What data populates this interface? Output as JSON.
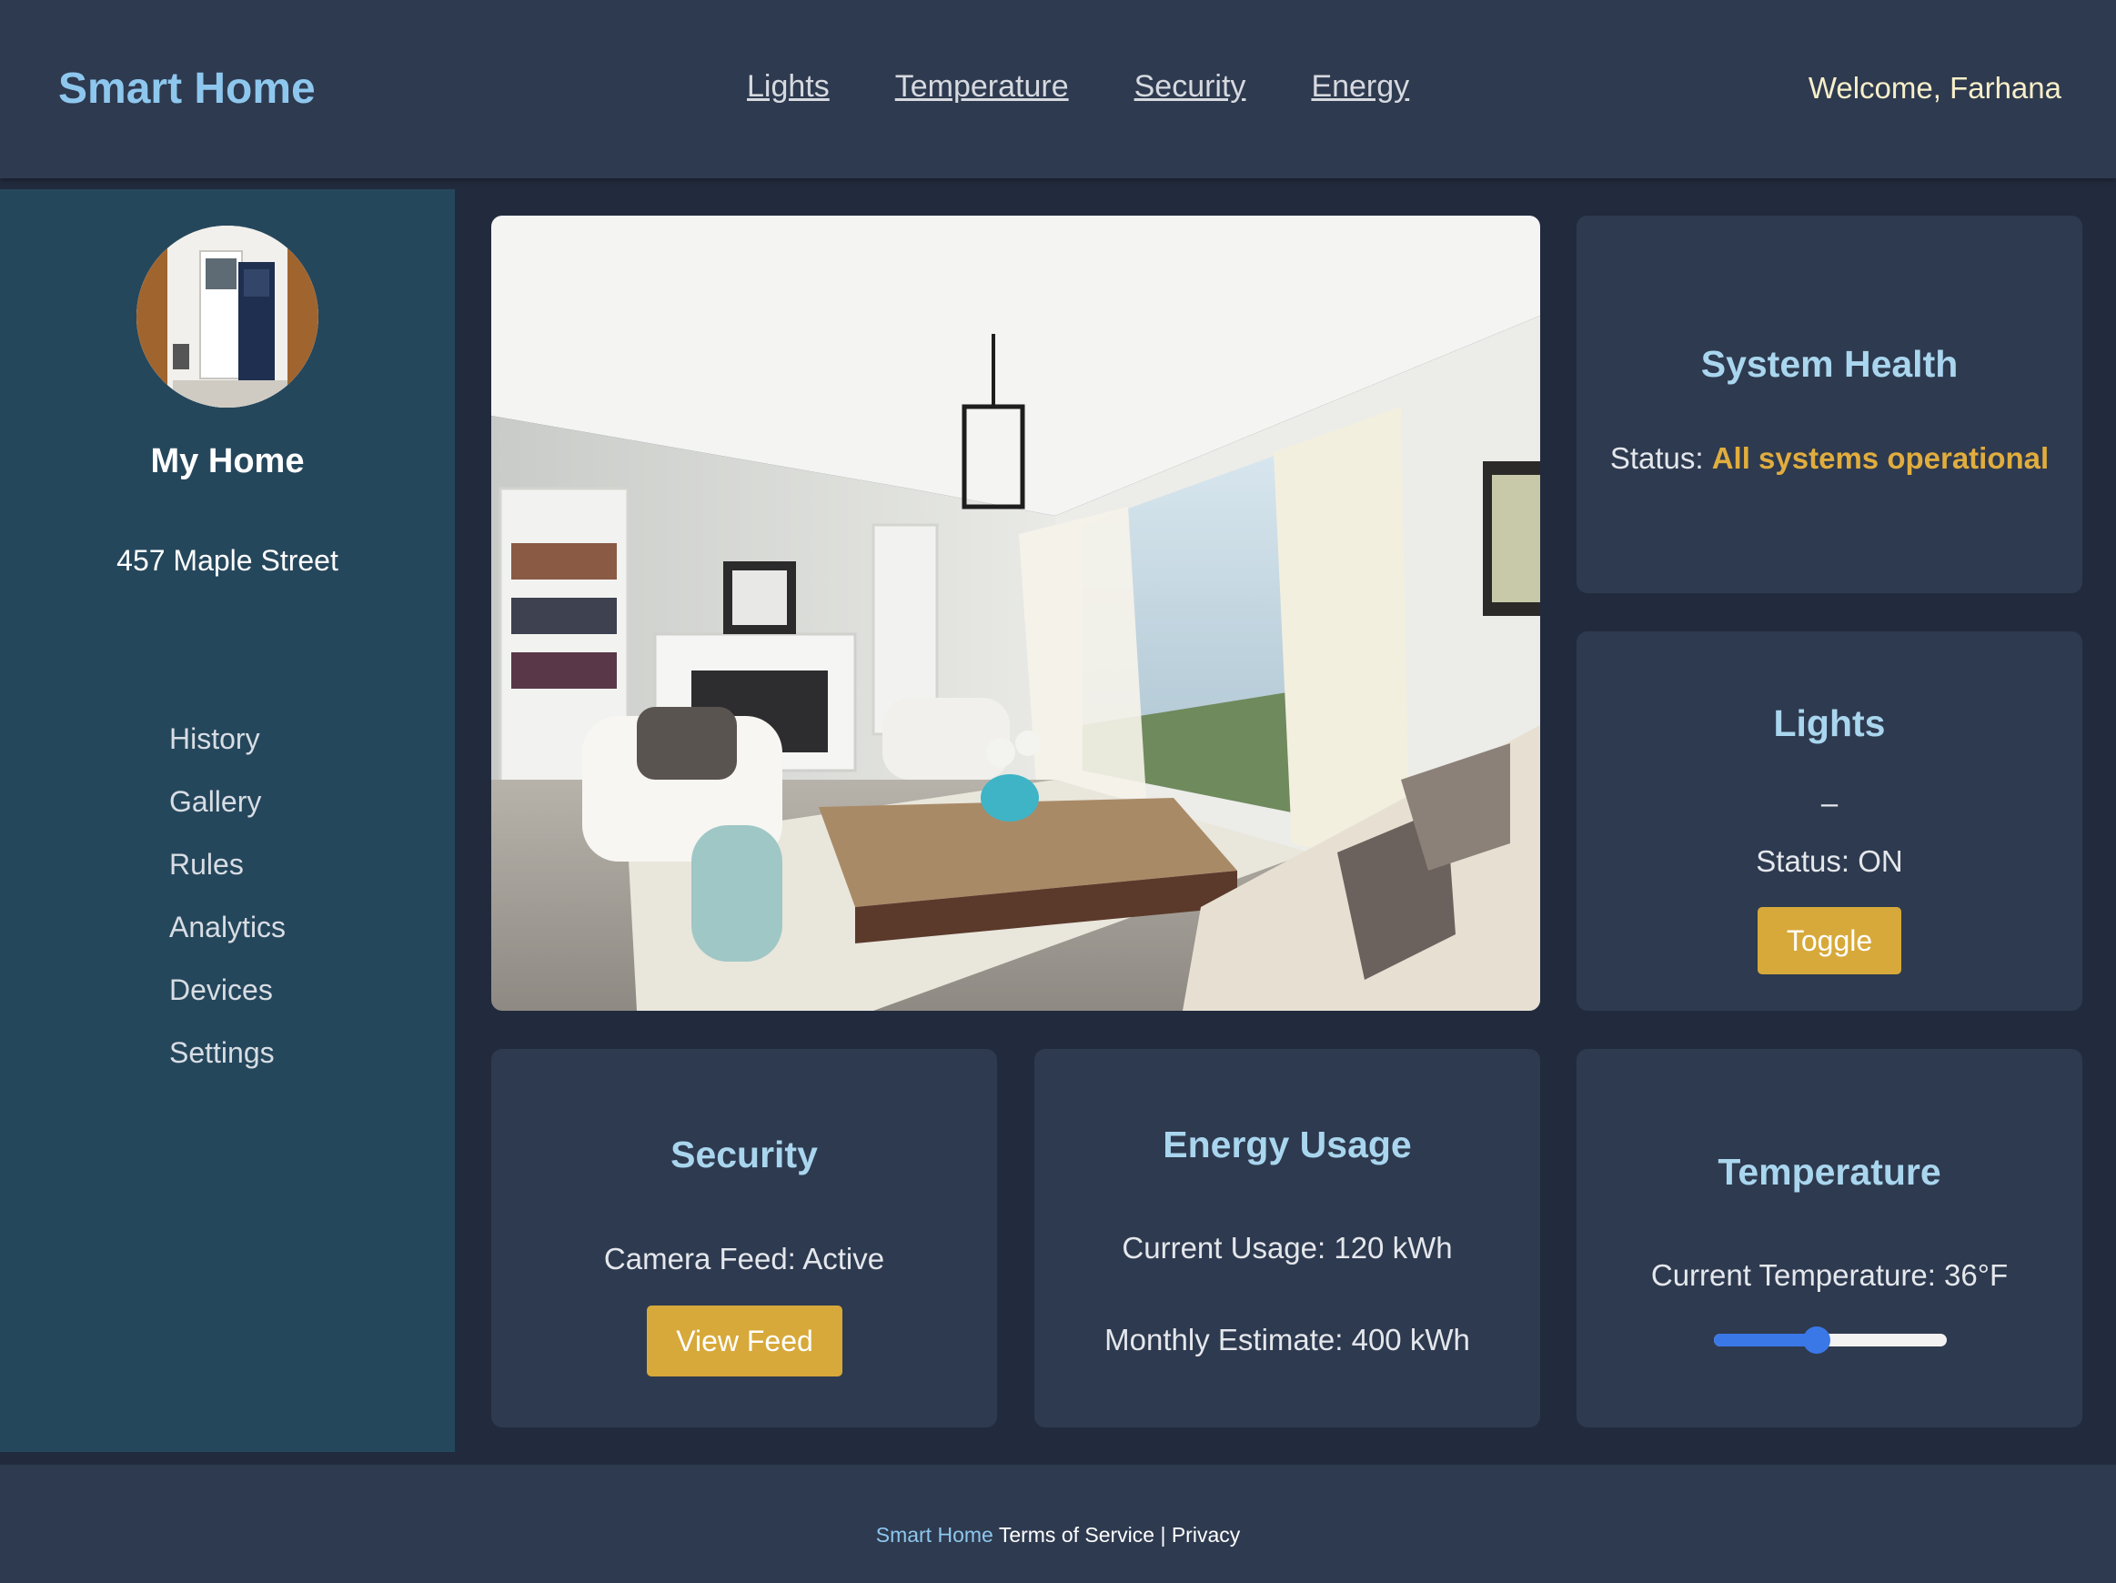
{
  "header": {
    "brand": "Smart Home",
    "nav": [
      "Lights",
      "Temperature",
      "Security",
      "Energy"
    ],
    "welcome": "Welcome, Farhana"
  },
  "sidebar": {
    "home_name": "My Home",
    "address": "457 Maple Street",
    "menu": [
      "History",
      "Gallery",
      "Rules",
      "Analytics",
      "Devices",
      "Settings"
    ]
  },
  "system_health": {
    "title": "System Health",
    "status_label": "Status:",
    "status_value": "All systems operational"
  },
  "lights": {
    "title": "Lights",
    "dash": "–",
    "status": "Status: ON",
    "button": "Toggle"
  },
  "security": {
    "title": "Security",
    "camera": "Camera Feed: Active",
    "button": "View Feed"
  },
  "energy": {
    "title": "Energy Usage",
    "current": "Current Usage: 120 kWh",
    "monthly": "Monthly Estimate: 400 kWh"
  },
  "temperature": {
    "title": "Temperature",
    "current": "Current Temperature: 36°F",
    "slider_fraction": 0.44
  },
  "footer": {
    "brand": "Smart Home",
    "terms": "Terms of Service",
    "separator": "|",
    "privacy": "Privacy"
  },
  "colors": {
    "page_bg": "#222b3e",
    "panel_bg": "#2e3a4f",
    "sidebar_bg": "#25475c",
    "brand": "#8ec7ee",
    "card_title": "#a9d6ee",
    "accent": "#d7a93a",
    "slider": "#3a78e8"
  }
}
